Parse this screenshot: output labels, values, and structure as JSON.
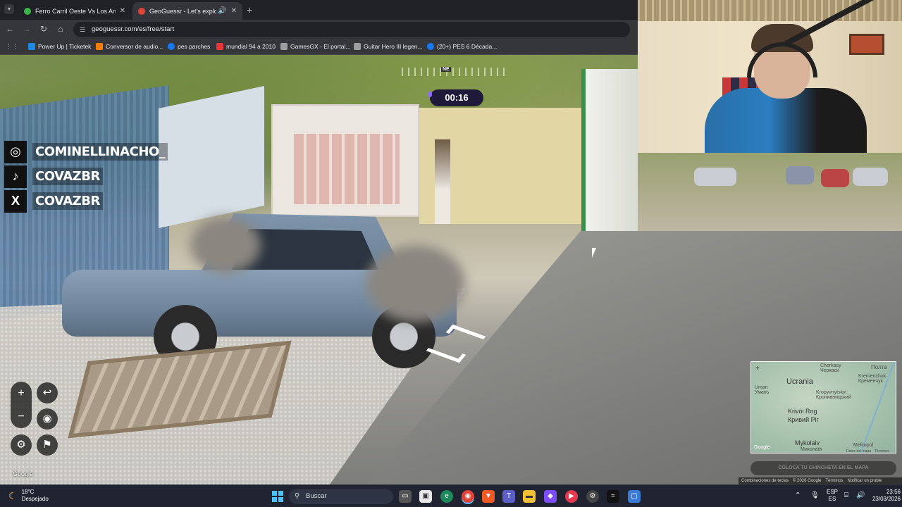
{
  "browser": {
    "tabs": [
      {
        "title": "Ferro Carril Oeste Vs Los Andes",
        "active": false,
        "favicon_color": "#3bb34a"
      },
      {
        "title": "GeoGuessr - Let's explore the world!",
        "active": true,
        "favicon_color": "#e0433a"
      }
    ],
    "new_tab": "+",
    "url": "geoguessr.com/es/free/start",
    "bookmarks": [
      {
        "label": "Power Up | Ticketek",
        "color": "#1e88e5"
      },
      {
        "label": "Conversor de audio...",
        "color": "#f57c00"
      },
      {
        "label": "pes parches",
        "color": "#1877f2"
      },
      {
        "label": "mundial 94 a 2010",
        "color": "#e53935"
      },
      {
        "label": "GamesGX - El portal...",
        "color": "#9e9e9e"
      },
      {
        "label": "Guitar Hero III legen...",
        "color": "#9e9e9e"
      },
      {
        "label": "(20+) PES 6 Década...",
        "color": "#1877f2"
      }
    ]
  },
  "game": {
    "compass_heading": "NE",
    "timer": "00:16",
    "social": [
      {
        "icon": "instagram-icon",
        "glyph": "◎",
        "handle": "COMINELLINACHO_"
      },
      {
        "icon": "tiktok-icon",
        "glyph": "♪",
        "handle": "COVAZBR"
      },
      {
        "icon": "x-icon",
        "glyph": "X",
        "handle": "COVAZBR"
      }
    ],
    "controls": {
      "zoom_in": "+",
      "zoom_out": "−",
      "undo": "↩",
      "checkpoint": "◉",
      "settings": "⚙",
      "flag": "⚑"
    },
    "google_logo": "Google",
    "minimap": {
      "labels": {
        "country": "Ucrania",
        "poltava": "Полта",
        "cherkasy": "Cherkasy\nЧеркаси",
        "kremenchuk": "Kremenchuk\nКременчук",
        "kropyvnytskyi": "Kropyvnytskyi\nКропивницький",
        "uman": "Uman\nУмань",
        "kryvyi_rog": "Krivói Rog",
        "kryvyi_rih": "Кривий Ріг",
        "mykolaiv": "Mykolaiv",
        "mykolaiv_cyr": "Миколаїв",
        "melitopol": "Melitopol",
        "google": "Google",
        "map_data": "Datos del mapa",
        "terms": "Términos"
      },
      "plus": "+"
    },
    "guess_button": "COLOCA TU CHINCHETA EN EL MAPA",
    "footer": [
      "Combinaciones de teclas",
      "© 2026 Google",
      "Términos",
      "Notificar un proble"
    ]
  },
  "taskbar": {
    "weather_temp": "18°C",
    "weather_desc": "Despejado",
    "search_placeholder": "Buscar",
    "lang_top": "ESP",
    "lang_bottom": "ES",
    "time": "23:56",
    "date": "23/03/2026",
    "colors": {
      "accent": "#4cc2ff",
      "taskbar_bg": "#1f2430"
    }
  }
}
